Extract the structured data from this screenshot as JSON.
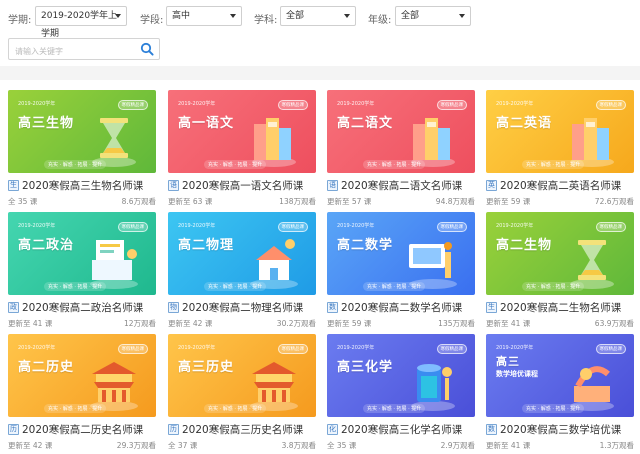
{
  "filters": {
    "term_label": "学期:",
    "term_value": "2019-2020学年上学期",
    "stage_label": "学段:",
    "stage_value": "高中",
    "subject_label": "学科:",
    "subject_value": "全部",
    "grade_label": "年级:",
    "grade_value": "全部"
  },
  "search": {
    "placeholder": "请输入关键字"
  },
  "courses": [
    {
      "year": "2019-2020学年",
      "badge": "寒假精品课",
      "thumb_title": "高三生物",
      "thumb_sub": "",
      "tags": "充实 · 解惑 · 拓展 · 提升",
      "subject": "生",
      "title": "2020寒假高三生物名师课",
      "meta": "全 35 课",
      "views": "8.6万观看",
      "bg1": "#9ad13a",
      "bg2": "#5fb83a",
      "icon": "hourglass"
    },
    {
      "year": "2019-2020学年",
      "badge": "寒假精品课",
      "thumb_title": "高一语文",
      "thumb_sub": "",
      "tags": "充实 · 解惑 · 拓展 · 提升",
      "subject": "语",
      "title": "2020寒假高一语文名师课",
      "meta": "更新至 63 课",
      "views": "138万观看",
      "bg1": "#f7707a",
      "bg2": "#ee4f5e",
      "icon": "books"
    },
    {
      "year": "2019-2020学年",
      "badge": "寒假精品课",
      "thumb_title": "高二语文",
      "thumb_sub": "",
      "tags": "充实 · 解惑 · 拓展 · 提升",
      "subject": "语",
      "title": "2020寒假高二语文名师课",
      "meta": "更新至 57 课",
      "views": "94.8万观看",
      "bg1": "#f7707a",
      "bg2": "#ee4f5e",
      "icon": "books"
    },
    {
      "year": "2019-2020学年",
      "badge": "寒假精品课",
      "thumb_title": "高二英语",
      "thumb_sub": "",
      "tags": "充实 · 解惑 · 拓展 · 提升",
      "subject": "英",
      "title": "2020寒假高二英语名师课",
      "meta": "更新至 59 课",
      "views": "72.6万观看",
      "bg1": "#ffcf45",
      "bg2": "#f6a81c",
      "icon": "books"
    },
    {
      "year": "2019-2020学年",
      "badge": "寒假精品课",
      "thumb_title": "高二政治",
      "thumb_sub": "",
      "tags": "充实 · 解惑 · 拓展 · 提升",
      "subject": "政",
      "title": "2020寒假高二政治名师课",
      "meta": "更新至 41 课",
      "views": "12万观看",
      "bg1": "#45d6b0",
      "bg2": "#1fb88e",
      "icon": "desk"
    },
    {
      "year": "2019-2020学年",
      "badge": "寒假精品课",
      "thumb_title": "高二物理",
      "thumb_sub": "",
      "tags": "充实 · 解惑 · 拓展 · 提升",
      "subject": "物",
      "title": "2020寒假高二物理名师课",
      "meta": "更新至 42 课",
      "views": "30.2万观看",
      "bg1": "#3dc6f2",
      "bg2": "#1f9be6",
      "icon": "house"
    },
    {
      "year": "2019-2020学年",
      "badge": "寒假精品课",
      "thumb_title": "高二数学",
      "thumb_sub": "",
      "tags": "充实 · 解惑 · 拓展 · 提升",
      "subject": "数",
      "title": "2020寒假高二数学名师课",
      "meta": "更新至 59 课",
      "views": "135万观看",
      "bg1": "#5aa6f7",
      "bg2": "#3a6ff0",
      "icon": "screen"
    },
    {
      "year": "2019-2020学年",
      "badge": "寒假精品课",
      "thumb_title": "高二生物",
      "thumb_sub": "",
      "tags": "充实 · 解惑 · 拓展 · 提升",
      "subject": "生",
      "title": "2020寒假高二生物名师课",
      "meta": "更新至 41 课",
      "views": "63.9万观看",
      "bg1": "#9ad13a",
      "bg2": "#5fb83a",
      "icon": "hourglass"
    },
    {
      "year": "2019-2020学年",
      "badge": "寒假精品课",
      "thumb_title": "高二历史",
      "thumb_sub": "",
      "tags": "充实 · 解惑 · 拓展 · 提升",
      "subject": "历",
      "title": "2020寒假高二历史名师课",
      "meta": "更新至 42 课",
      "views": "29.3万观看",
      "bg1": "#ffc54a",
      "bg2": "#f59a1e",
      "icon": "temple"
    },
    {
      "year": "2019-2020学年",
      "badge": "寒假精品课",
      "thumb_title": "高三历史",
      "thumb_sub": "",
      "tags": "充实 · 解惑 · 拓展 · 提升",
      "subject": "历",
      "title": "2020寒假高三历史名师课",
      "meta": "全 37 课",
      "views": "3.8万观看",
      "bg1": "#ffc54a",
      "bg2": "#f59a1e",
      "icon": "temple"
    },
    {
      "year": "2019-2020学年",
      "badge": "寒假精品课",
      "thumb_title": "高三化学",
      "thumb_sub": "",
      "tags": "充实 · 解惑 · 拓展 · 提升",
      "subject": "化",
      "title": "2020寒假高三化学名师课",
      "meta": "全 35 课",
      "views": "2.9万观看",
      "bg1": "#6b7cf0",
      "bg2": "#4a4fd8",
      "icon": "flask"
    },
    {
      "year": "2019-2020学年",
      "badge": "寒假精品课",
      "thumb_title": "高三",
      "thumb_sub": "数学培优课程",
      "tags": "充实 · 解惑 · 拓展 · 提升",
      "subject": "数",
      "title": "2020寒假高三数学培优课",
      "meta": "更新至 41 课",
      "views": "1.3万观看",
      "bg1": "#6b7cf0",
      "bg2": "#4a4fd8",
      "icon": "podium"
    }
  ]
}
